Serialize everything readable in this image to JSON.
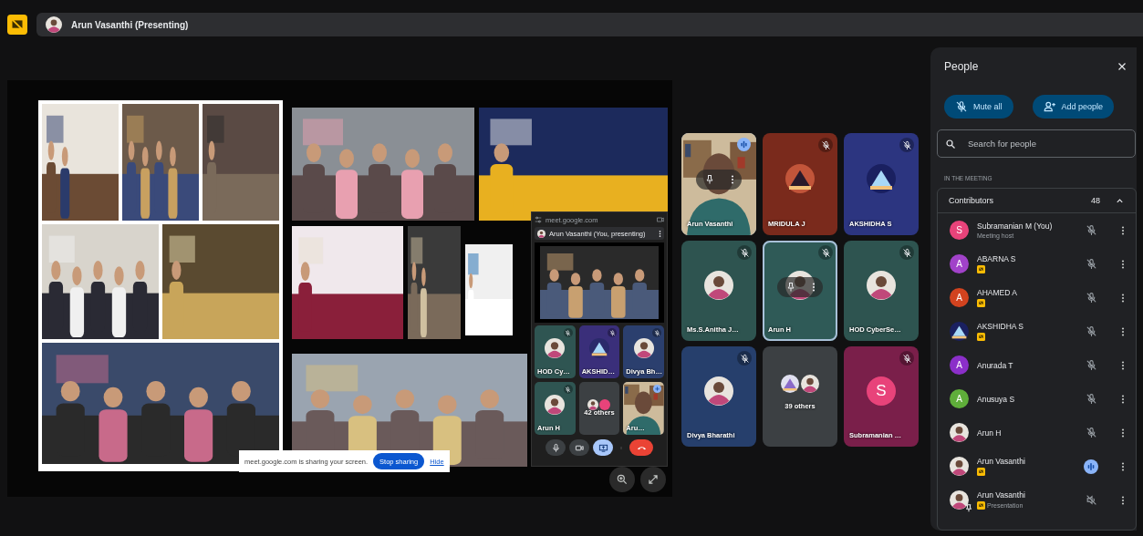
{
  "top_bar": {
    "presenter": "Arun Vasanthi (Presenting)"
  },
  "share_bar": {
    "message": "meet.google.com is sharing your screen.",
    "stop": "Stop sharing",
    "hide": "Hide"
  },
  "mini_window": {
    "url": "meet.google.com",
    "presenter": "Arun Vasanthi (You, presenting)",
    "tiles": [
      {
        "kind": "avatar",
        "name": "HOD Cy…",
        "color": "#2f5552",
        "muted": true,
        "speaking": false
      },
      {
        "name": "AKSHID…",
        "color": "#3a2f7a",
        "muted": true,
        "speaking": false
      },
      {
        "kind": "avatar",
        "name": "Divya Bh…",
        "color": "#2b3f6e",
        "muted": true,
        "speaking": false
      },
      {
        "kind": "avatar",
        "name": "Arun H",
        "color": "#2f5552",
        "muted": true,
        "speaking": false
      },
      {
        "kind": "others",
        "name": "42 others",
        "color": "#3c4043",
        "muted": false,
        "speaking": false
      },
      {
        "kind": "video",
        "name": "Aru…",
        "muted": false,
        "speaking": true
      }
    ],
    "controls": [
      {
        "kind": "mic",
        "selected": false
      },
      {
        "kind": "camera",
        "selected": false
      },
      {
        "kind": "present",
        "selected": true
      },
      {
        "kind": "more",
        "selected": false
      },
      {
        "kind": "end",
        "selected": false
      }
    ]
  },
  "tiles": [
    {
      "kind": "video",
      "name": "Arun Vasanthi",
      "muted": false,
      "speaking": true,
      "hover": true
    },
    {
      "name": "MRIDULA J",
      "color": "#7a2a1c",
      "muted": true,
      "speaking": false,
      "hover": false
    },
    {
      "name": "AKSHIDHA S",
      "color": "#2c3580",
      "muted": true,
      "speaking": false,
      "hover": false
    },
    {
      "kind": "avatar",
      "name": "Ms.S.Anitha J…",
      "color": "#2e5450",
      "muted": true,
      "speaking": false,
      "hover": false
    },
    {
      "kind": "avatar",
      "name": "Arun H",
      "color": "#2f5a57",
      "muted": true,
      "speaking": false,
      "hover": true
    },
    {
      "kind": "avatar",
      "name": "HOD CyberSe…",
      "color": "#2e5450",
      "muted": true,
      "speaking": false,
      "hover": false
    },
    {
      "kind": "avatar",
      "name": "Divya Bharathi",
      "color": "#263f6c",
      "muted": true,
      "speaking": false,
      "hover": false
    },
    {
      "kind": "others",
      "name": "39 others",
      "color": "#3c4043",
      "muted": false,
      "speaking": false,
      "hover": false
    },
    {
      "kind": "initial",
      "name": "Subramanian …",
      "color": "#7a1f4a",
      "avatar": {
        "initial": "S",
        "color": "#e8437a"
      },
      "muted": true,
      "speaking": false,
      "hover": false
    }
  ],
  "people_panel": {
    "title": "People",
    "mute_all": "Mute all",
    "add_people": "Add people",
    "search_placeholder": "Search for people",
    "section": "IN THE MEETING",
    "group": {
      "label": "Contributors",
      "count": "48",
      "expanded": true
    },
    "people": [
      {
        "kind": "person",
        "name": "Subramanian M (You)",
        "subtitle": "Meeting host",
        "avatar": {
          "kind": "initial",
          "initial": "S",
          "color": "#e8437a"
        },
        "badge": false,
        "muted": true,
        "speaking": false
      },
      {
        "kind": "person",
        "name": "ABARNA S",
        "avatar": {
          "kind": "initial",
          "initial": "A",
          "color": "#a142c9"
        },
        "badge": true,
        "muted": true,
        "speaking": false
      },
      {
        "kind": "person",
        "name": "AHAMED A",
        "avatar": {
          "kind": "initial",
          "initial": "A",
          "color": "#d2431f"
        },
        "badge": true,
        "muted": true,
        "speaking": false
      },
      {
        "kind": "person",
        "name": "AKSHIDHA S",
        "badge": true,
        "muted": true,
        "speaking": false
      },
      {
        "kind": "person",
        "name": "Anurada T",
        "avatar": {
          "kind": "initial",
          "initial": "A",
          "color": "#8b2fc9"
        },
        "badge": false,
        "muted": true,
        "speaking": false
      },
      {
        "kind": "person",
        "name": "Anusuya S",
        "avatar": {
          "kind": "initial",
          "initial": "A",
          "color": "#5fae3a"
        },
        "badge": false,
        "muted": true,
        "speaking": false
      },
      {
        "kind": "person",
        "name": "Arun H",
        "badge": false,
        "muted": true,
        "speaking": false
      },
      {
        "kind": "person",
        "name": "Arun Vasanthi",
        "badge": true,
        "muted": false,
        "speaking": true
      },
      {
        "kind": "presentation",
        "name": "Arun Vasanthi",
        "subtitle": "Presentation",
        "badge": true,
        "muted": true,
        "speaking": false
      }
    ]
  }
}
